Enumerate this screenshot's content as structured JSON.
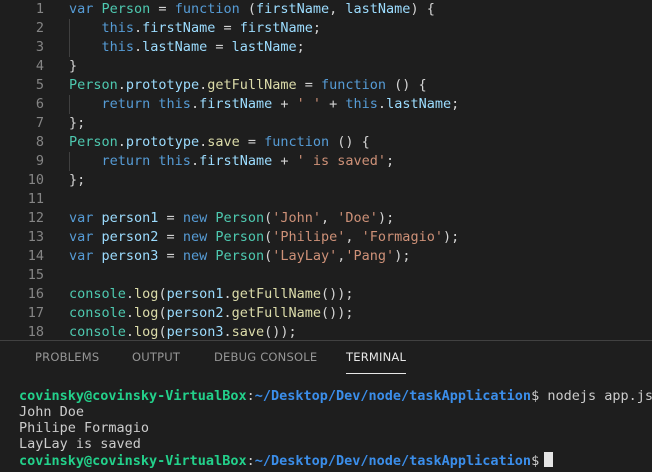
{
  "editor": {
    "line_numbers": [
      "1",
      "2",
      "3",
      "4",
      "5",
      "6",
      "7",
      "8",
      "9",
      "10",
      "11",
      "12",
      "13",
      "14",
      "15",
      "16",
      "17",
      "18"
    ],
    "lines": [
      [
        [
          "k",
          "var "
        ],
        [
          "t",
          "Person"
        ],
        [
          "p",
          " = "
        ],
        [
          "k",
          "function"
        ],
        [
          "p",
          " ("
        ],
        [
          "v",
          "firstName"
        ],
        [
          "p",
          ", "
        ],
        [
          "v",
          "lastName"
        ],
        [
          "p",
          ") {"
        ]
      ],
      [
        [
          "p",
          "    "
        ],
        [
          "k",
          "this"
        ],
        [
          "p",
          "."
        ],
        [
          "v",
          "firstName"
        ],
        [
          "p",
          " = "
        ],
        [
          "v",
          "firstName"
        ],
        [
          "p",
          ";"
        ]
      ],
      [
        [
          "p",
          "    "
        ],
        [
          "k",
          "this"
        ],
        [
          "p",
          "."
        ],
        [
          "v",
          "lastName"
        ],
        [
          "p",
          " = "
        ],
        [
          "v",
          "lastName"
        ],
        [
          "p",
          ";"
        ]
      ],
      [
        [
          "p",
          "}"
        ]
      ],
      [
        [
          "t",
          "Person"
        ],
        [
          "p",
          "."
        ],
        [
          "v",
          "prototype"
        ],
        [
          "p",
          "."
        ],
        [
          "f",
          "getFullName"
        ],
        [
          "p",
          " = "
        ],
        [
          "k",
          "function"
        ],
        [
          "p",
          " () {"
        ]
      ],
      [
        [
          "p",
          "    "
        ],
        [
          "k",
          "return "
        ],
        [
          "k",
          "this"
        ],
        [
          "p",
          "."
        ],
        [
          "v",
          "firstName"
        ],
        [
          "p",
          " + "
        ],
        [
          "s",
          "' '"
        ],
        [
          "p",
          " + "
        ],
        [
          "k",
          "this"
        ],
        [
          "p",
          "."
        ],
        [
          "v",
          "lastName"
        ],
        [
          "p",
          ";"
        ]
      ],
      [
        [
          "p",
          "};"
        ]
      ],
      [
        [
          "t",
          "Person"
        ],
        [
          "p",
          "."
        ],
        [
          "v",
          "prototype"
        ],
        [
          "p",
          "."
        ],
        [
          "f",
          "save"
        ],
        [
          "p",
          " = "
        ],
        [
          "k",
          "function"
        ],
        [
          "p",
          " () {"
        ]
      ],
      [
        [
          "p",
          "    "
        ],
        [
          "k",
          "return "
        ],
        [
          "k",
          "this"
        ],
        [
          "p",
          "."
        ],
        [
          "v",
          "firstName"
        ],
        [
          "p",
          " + "
        ],
        [
          "s",
          "' is saved'"
        ],
        [
          "p",
          ";"
        ]
      ],
      [
        [
          "p",
          "};"
        ]
      ],
      [],
      [
        [
          "k",
          "var "
        ],
        [
          "v",
          "person1"
        ],
        [
          "p",
          " = "
        ],
        [
          "k",
          "new "
        ],
        [
          "t",
          "Person"
        ],
        [
          "p",
          "("
        ],
        [
          "s",
          "'John'"
        ],
        [
          "p",
          ", "
        ],
        [
          "s",
          "'Doe'"
        ],
        [
          "p",
          ");"
        ]
      ],
      [
        [
          "k",
          "var "
        ],
        [
          "v",
          "person2"
        ],
        [
          "p",
          " = "
        ],
        [
          "k",
          "new "
        ],
        [
          "t",
          "Person"
        ],
        [
          "p",
          "("
        ],
        [
          "s",
          "'Philipe'"
        ],
        [
          "p",
          ", "
        ],
        [
          "s",
          "'Formagio'"
        ],
        [
          "p",
          ");"
        ]
      ],
      [
        [
          "k",
          "var "
        ],
        [
          "v",
          "person3"
        ],
        [
          "p",
          " = "
        ],
        [
          "k",
          "new "
        ],
        [
          "t",
          "Person"
        ],
        [
          "p",
          "("
        ],
        [
          "s",
          "'LayLay'"
        ],
        [
          "p",
          ","
        ],
        [
          "s",
          "'Pang'"
        ],
        [
          "p",
          ");"
        ]
      ],
      [],
      [
        [
          "t",
          "console"
        ],
        [
          "p",
          "."
        ],
        [
          "f",
          "log"
        ],
        [
          "p",
          "("
        ],
        [
          "v",
          "person1"
        ],
        [
          "p",
          "."
        ],
        [
          "f",
          "getFullName"
        ],
        [
          "p",
          "());"
        ]
      ],
      [
        [
          "t",
          "console"
        ],
        [
          "p",
          "."
        ],
        [
          "f",
          "log"
        ],
        [
          "p",
          "("
        ],
        [
          "v",
          "person2"
        ],
        [
          "p",
          "."
        ],
        [
          "f",
          "getFullName"
        ],
        [
          "p",
          "());"
        ]
      ],
      [
        [
          "t",
          "console"
        ],
        [
          "p",
          "."
        ],
        [
          "f",
          "log"
        ],
        [
          "p",
          "("
        ],
        [
          "v",
          "person3"
        ],
        [
          "p",
          "."
        ],
        [
          "f",
          "save"
        ],
        [
          "p",
          "());"
        ]
      ]
    ]
  },
  "panel": {
    "tabs": [
      {
        "label": "PROBLEMS",
        "active": false
      },
      {
        "label": "OUTPUT",
        "active": false
      },
      {
        "label": "DEBUG CONSOLE",
        "active": false
      },
      {
        "label": "TERMINAL",
        "active": true
      }
    ]
  },
  "terminal": {
    "prompt_user": "covinsky@covinsky-VirtualBox",
    "prompt_sep": ":",
    "prompt_path": "~/Desktop/Dev/node/taskApplication",
    "prompt_symbol": "$",
    "command": "nodejs app.js",
    "output": [
      "John Doe",
      "Philipe Formagio",
      "LayLay is saved"
    ]
  },
  "colors": {
    "background": "#1e1e1e",
    "keyword": "#569cd6",
    "type": "#4ec9b0",
    "function": "#dcdcaa",
    "variable": "#9cdcfe",
    "string": "#ce9178",
    "prompt_user": "#23d18b",
    "prompt_path": "#3b8eea"
  }
}
